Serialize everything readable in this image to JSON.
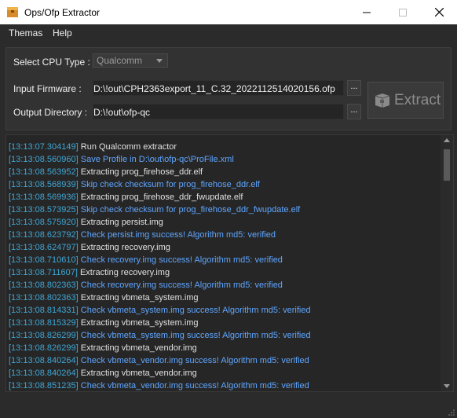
{
  "window": {
    "title": "Ops/Ofp Extractor"
  },
  "menu": {
    "themas": "Themas",
    "help": "Help"
  },
  "settings": {
    "cpu_label": "Select CPU Type :",
    "cpu_value": "Qualcomm",
    "input_label": "Input Firmware :",
    "input_value": "D:\\!out\\CPH2363export_11_C.32_2022112514020156.ofp",
    "output_label": "Output Directory :",
    "output_value": "D:\\!out\\ofp-qc",
    "browse_label": "...",
    "extract_label": "Extract"
  },
  "log": [
    {
      "ts": "[13:13:07.304149]",
      "msg": "Run Qualcomm extractor",
      "style": "white"
    },
    {
      "ts": "[13:13:08.560960]",
      "msg": "Save Profile in D:\\out\\ofp-qc\\ProFile.xml",
      "style": "blue"
    },
    {
      "ts": "[13:13:08.563952]",
      "msg": "Extracting prog_firehose_ddr.elf",
      "style": "white"
    },
    {
      "ts": "[13:13:08.568939]",
      "msg": "Skip check checksum for prog_firehose_ddr.elf",
      "style": "blue"
    },
    {
      "ts": "[13:13:08.569936]",
      "msg": "Extracting prog_firehose_ddr_fwupdate.elf",
      "style": "white"
    },
    {
      "ts": "[13:13:08.573925]",
      "msg": "Skip check checksum for prog_firehose_ddr_fwupdate.elf",
      "style": "blue"
    },
    {
      "ts": "[13:13:08.575920]",
      "msg": "Extracting persist.img",
      "style": "white"
    },
    {
      "ts": "[13:13:08.623792]",
      "msg": "Check persist.img success! Algorithm md5: verified",
      "style": "blue"
    },
    {
      "ts": "[13:13:08.624797]",
      "msg": "Extracting recovery.img",
      "style": "white"
    },
    {
      "ts": "[13:13:08.710610]",
      "msg": "Check recovery.img success! Algorithm md5: verified",
      "style": "blue"
    },
    {
      "ts": "[13:13:08.711607]",
      "msg": "Extracting recovery.img",
      "style": "white"
    },
    {
      "ts": "[13:13:08.802363]",
      "msg": "Check recovery.img success! Algorithm md5: verified",
      "style": "blue"
    },
    {
      "ts": "[13:13:08.802363]",
      "msg": "Extracting vbmeta_system.img",
      "style": "white"
    },
    {
      "ts": "[13:13:08.814331]",
      "msg": "Check vbmeta_system.img success! Algorithm md5: verified",
      "style": "blue"
    },
    {
      "ts": "[13:13:08.815329]",
      "msg": "Extracting vbmeta_system.img",
      "style": "white"
    },
    {
      "ts": "[13:13:08.826299]",
      "msg": "Check vbmeta_system.img success! Algorithm md5: verified",
      "style": "blue"
    },
    {
      "ts": "[13:13:08.826299]",
      "msg": "Extracting vbmeta_vendor.img",
      "style": "white"
    },
    {
      "ts": "[13:13:08.840264]",
      "msg": "Check vbmeta_vendor.img success! Algorithm md5: verified",
      "style": "blue"
    },
    {
      "ts": "[13:13:08.840264]",
      "msg": "Extracting vbmeta_vendor.img",
      "style": "white"
    },
    {
      "ts": "[13:13:08.851235]",
      "msg": "Check vbmeta_vendor.img success! Algorithm md5: verified",
      "style": "blue"
    }
  ],
  "colors": {
    "timestamp": "#3fa7d6",
    "info": "#e0e0e0",
    "success": "#5fa6ff",
    "background": "#2b2b2b"
  },
  "icons": {
    "app": "package-box-icon",
    "extract": "package-box-icon"
  }
}
